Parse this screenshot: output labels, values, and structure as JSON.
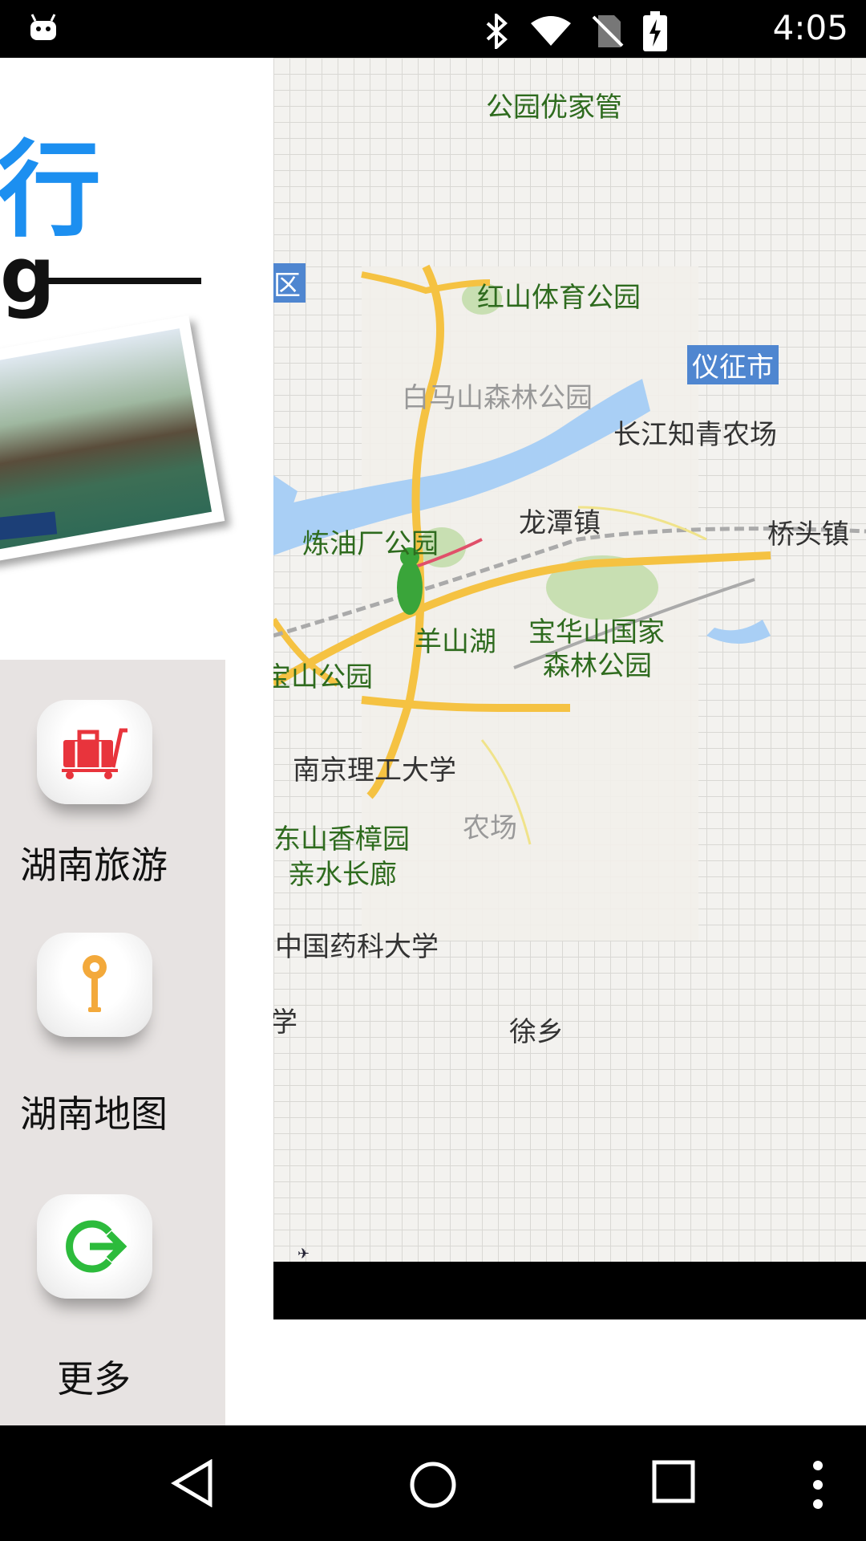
{
  "status_bar": {
    "time": "4:05",
    "icons": [
      "android-icon",
      "bluetooth-icon",
      "wifi-icon",
      "no-sim-icon",
      "battery-charging-icon"
    ]
  },
  "header": {
    "title_partial": "行",
    "subtitle_partial": "g"
  },
  "menu": {
    "items": [
      {
        "label": "湖南旅游",
        "icon": "luggage-icon",
        "color": "#e8343c"
      },
      {
        "label": "湖南地图",
        "icon": "map-pin-icon",
        "color": "#f3a93b"
      },
      {
        "label": "更多",
        "icon": "exit-arrow-icon",
        "color": "#2dbb3c"
      }
    ]
  },
  "map": {
    "labels": {
      "park1": "公园优家管",
      "park2": "红山体育公园",
      "city": "仪征市",
      "park3": "白马山森林公园",
      "farm1": "长江知青农场",
      "town1": "龙潭镇",
      "park4": "炼油厂公园",
      "town2": "桥头镇",
      "lake": "羊山湖",
      "park5": "宝华山国家",
      "park5b": "森林公园",
      "park6": "宝山公园",
      "univ1": "南京理工大学",
      "farm2": "农场",
      "park7": "东山香樟园",
      "park7b": "亲水长廊",
      "univ2": "中国药科大学",
      "univ3_partial": "学",
      "town3": "徐乡",
      "edge_partial": "区"
    },
    "colors": {
      "road": "#f5c242",
      "river": "#a9cff5",
      "park": "#c8dfb2"
    }
  },
  "nav_bar": {
    "buttons": [
      "back",
      "home",
      "recents",
      "overflow-menu"
    ]
  }
}
